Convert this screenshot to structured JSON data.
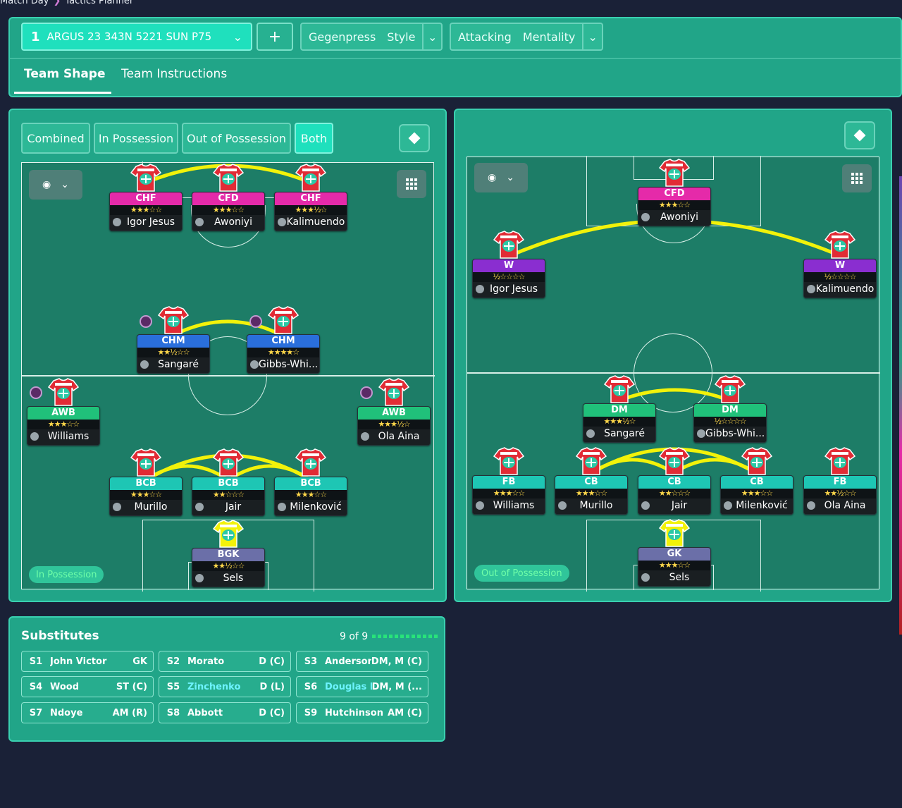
{
  "breadcrumb": {
    "a": "Match Day",
    "b": "Tactics Planner"
  },
  "tactic": {
    "number": "1",
    "name": "ARGUS 23 343N 5221 SUN P75",
    "add": "+"
  },
  "style": {
    "a": "Gegenpress",
    "b": "Style"
  },
  "mentality": {
    "a": "Attacking",
    "b": "Mentality"
  },
  "tabs": {
    "shape": "Team Shape",
    "instructions": "Team Instructions"
  },
  "phase_tabs": {
    "combined": "Combined",
    "in": "In Possession",
    "out": "Out of Possession",
    "both": "Both"
  },
  "left_pitch": {
    "label": "In Possession",
    "players": [
      {
        "role": "CHF",
        "stars": "★★★☆☆",
        "name": "Igor Jesus"
      },
      {
        "role": "CFD",
        "stars": "★★★☆☆",
        "name": "Awoniyi"
      },
      {
        "role": "CHF",
        "stars": "★★★½☆",
        "name": "Kalimuendo"
      },
      {
        "role": "CHM",
        "stars": "★★½☆☆",
        "name": "Sangaré"
      },
      {
        "role": "CHM",
        "stars": "★★★★☆",
        "name": "Gibbs-Whi..."
      },
      {
        "role": "AWB",
        "stars": "★★★☆☆",
        "name": "Williams"
      },
      {
        "role": "AWB",
        "stars": "★★★½☆",
        "name": "Ola Aina"
      },
      {
        "role": "BCB",
        "stars": "★★★☆☆",
        "name": "Murillo"
      },
      {
        "role": "BCB",
        "stars": "★★☆☆☆",
        "name": "Jair"
      },
      {
        "role": "BCB",
        "stars": "★★★☆☆",
        "name": "Milenković"
      },
      {
        "role": "BGK",
        "stars": "★★½☆☆",
        "name": "Sels"
      }
    ]
  },
  "right_pitch": {
    "label": "Out of Possession",
    "players": [
      {
        "role": "CFD",
        "stars": "★★★☆☆",
        "name": "Awoniyi"
      },
      {
        "role": "W",
        "stars": "½☆☆☆☆",
        "name": "Igor Jesus"
      },
      {
        "role": "W",
        "stars": "½☆☆☆☆",
        "name": "Kalimuendo"
      },
      {
        "role": "DM",
        "stars": "★★★½☆",
        "name": "Sangaré"
      },
      {
        "role": "DM",
        "stars": "½☆☆☆☆",
        "name": "Gibbs-Whi..."
      },
      {
        "role": "FB",
        "stars": "★★★☆☆",
        "name": "Williams"
      },
      {
        "role": "CB",
        "stars": "★★★☆☆",
        "name": "Murillo"
      },
      {
        "role": "CB",
        "stars": "★★☆☆☆",
        "name": "Jair"
      },
      {
        "role": "CB",
        "stars": "★★★☆☆",
        "name": "Milenković"
      },
      {
        "role": "FB",
        "stars": "★★½☆☆",
        "name": "Ola Aina"
      },
      {
        "role": "GK",
        "stars": "★★★☆☆",
        "name": "Sels"
      }
    ]
  },
  "subs": {
    "title": "Substitutes",
    "count": "9 of 9",
    "items": [
      {
        "slot": "S1",
        "name": "John Victor",
        "pos": "GK"
      },
      {
        "slot": "S2",
        "name": "Morato",
        "pos": "D (C)"
      },
      {
        "slot": "S3",
        "name": "Anderson",
        "pos": "DM, M (C)"
      },
      {
        "slot": "S4",
        "name": "Wood",
        "pos": "ST (C)"
      },
      {
        "slot": "S5",
        "name": "Zinchenko",
        "pos": "D (L)"
      },
      {
        "slot": "S6",
        "name": "Douglas L...",
        "pos": "DM, M (..."
      },
      {
        "slot": "S7",
        "name": "Ndoye",
        "pos": "AM (R)"
      },
      {
        "slot": "S8",
        "name": "Abbott",
        "pos": "D (C)"
      },
      {
        "slot": "S9",
        "name": "Hutchinson",
        "pos": "AM (C)"
      }
    ]
  },
  "colors": {
    "panel": "#21a588",
    "pitch": "#1d7d67",
    "accent": "#1fe0bd",
    "links": "#f2f20a"
  }
}
